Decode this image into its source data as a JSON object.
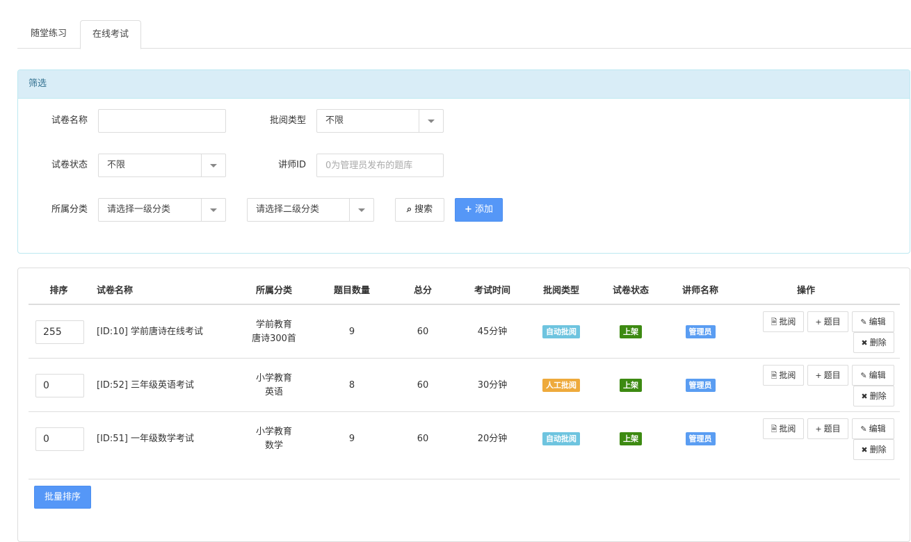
{
  "tabs": [
    {
      "label": "随堂练习",
      "active": false
    },
    {
      "label": "在线考试",
      "active": true
    }
  ],
  "filter": {
    "title": "筛选",
    "paper_name_label": "试卷名称",
    "paper_name_value": "",
    "review_type_label": "批阅类型",
    "review_type_value": "不限",
    "paper_status_label": "试卷状态",
    "paper_status_value": "不限",
    "teacher_id_label": "讲师ID",
    "teacher_id_placeholder": "0为管理员发布的题库",
    "category_label": "所属分类",
    "category1_value": "请选择一级分类",
    "category2_value": "请选择二级分类",
    "search_label": "搜索",
    "add_label": "添加"
  },
  "table": {
    "headers": {
      "sort": "排序",
      "name": "试卷名称",
      "category": "所属分类",
      "count": "题目数量",
      "score": "总分",
      "time": "考试时间",
      "review": "批阅类型",
      "status": "试卷状态",
      "teacher": "讲师名称",
      "ops": "操作"
    },
    "rows": [
      {
        "sort": "255",
        "name": "[ID:10] 学前唐诗在线考试",
        "cat1": "学前教育",
        "cat2": "唐诗300首",
        "count": "9",
        "score": "60",
        "time": "45分钟",
        "review": "自动批阅",
        "status": "上架",
        "teacher": "管理员"
      },
      {
        "sort": "0",
        "name": "[ID:52] 三年级英语考试",
        "cat1": "小学教育",
        "cat2": "英语",
        "count": "8",
        "score": "60",
        "time": "30分钟",
        "review": "人工批阅",
        "status": "上架",
        "teacher": "管理员"
      },
      {
        "sort": "0",
        "name": "[ID:51] 一年级数学考试",
        "cat1": "小学教育",
        "cat2": "数学",
        "count": "9",
        "score": "60",
        "time": "20分钟",
        "review": "自动批阅",
        "status": "上架",
        "teacher": "管理员"
      }
    ],
    "ops": {
      "review": "批阅",
      "questions": "题目",
      "edit": "编辑",
      "delete": "删除"
    },
    "batch_sort_label": "批量排序"
  },
  "colors": {
    "primary": "#5597f7",
    "panel_head_bg": "#d9edf7",
    "auto_review": "#6ec4df",
    "manual_review": "#eeaa3c",
    "on_shelf": "#3d8a12",
    "admin": "#5a9df2"
  }
}
